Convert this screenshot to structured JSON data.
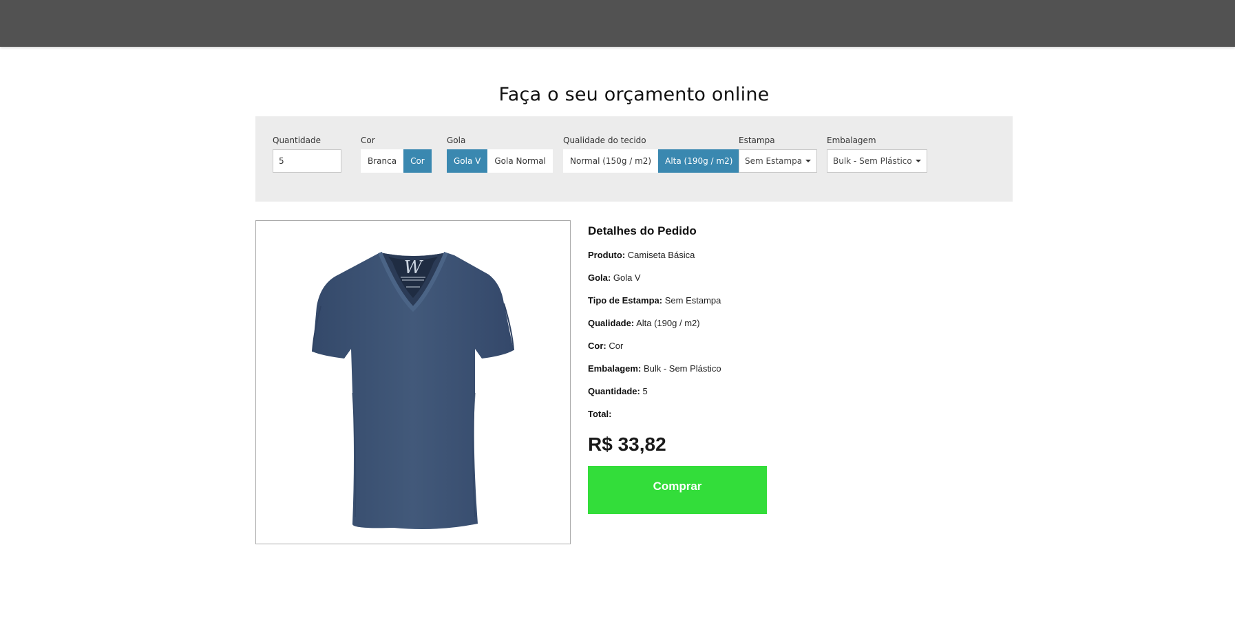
{
  "page": {
    "title": "Faça o seu orçamento online"
  },
  "options": {
    "quantity": {
      "label": "Quantidade",
      "value": "5"
    },
    "color": {
      "label": "Cor",
      "options": [
        "Branca",
        "Cor"
      ],
      "selected": "Cor"
    },
    "collar": {
      "label": "Gola",
      "options": [
        "Gola V",
        "Gola Normal"
      ],
      "selected": "Gola V"
    },
    "fabric": {
      "label": "Qualidade do tecido",
      "options": [
        "Normal (150g / m2)",
        "Alta (190g / m2)"
      ],
      "selected": "Alta (190g / m2)"
    },
    "print": {
      "label": "Estampa",
      "value": "Sem Estampa"
    },
    "packaging": {
      "label": "Embalagem",
      "value": "Bulk - Sem Plástico"
    }
  },
  "product_image": {
    "icon": "tshirt-vneck-icon",
    "color": "#3e5572",
    "label_letter": "W"
  },
  "details": {
    "title": "Detalhes do Pedido",
    "rows": [
      {
        "label": "Produto:",
        "value": "Camiseta Básica"
      },
      {
        "label": "Gola:",
        "value": "Gola V"
      },
      {
        "label": "Tipo de Estampa:",
        "value": "Sem Estampa"
      },
      {
        "label": "Qualidade:",
        "value": "Alta (190g / m2)"
      },
      {
        "label": "Cor:",
        "value": "Cor"
      },
      {
        "label": "Embalagem:",
        "value": "Bulk - Sem Plástico"
      },
      {
        "label": "Quantidade:",
        "value": "5"
      },
      {
        "label": "Total:",
        "value": ""
      }
    ],
    "price": "R$ 33,82"
  },
  "buy_button": {
    "label": "Comprar",
    "color": "#33dd3a"
  },
  "colors": {
    "accent": "#3a88b0",
    "topbar": "#525252",
    "panel": "#ececec"
  }
}
